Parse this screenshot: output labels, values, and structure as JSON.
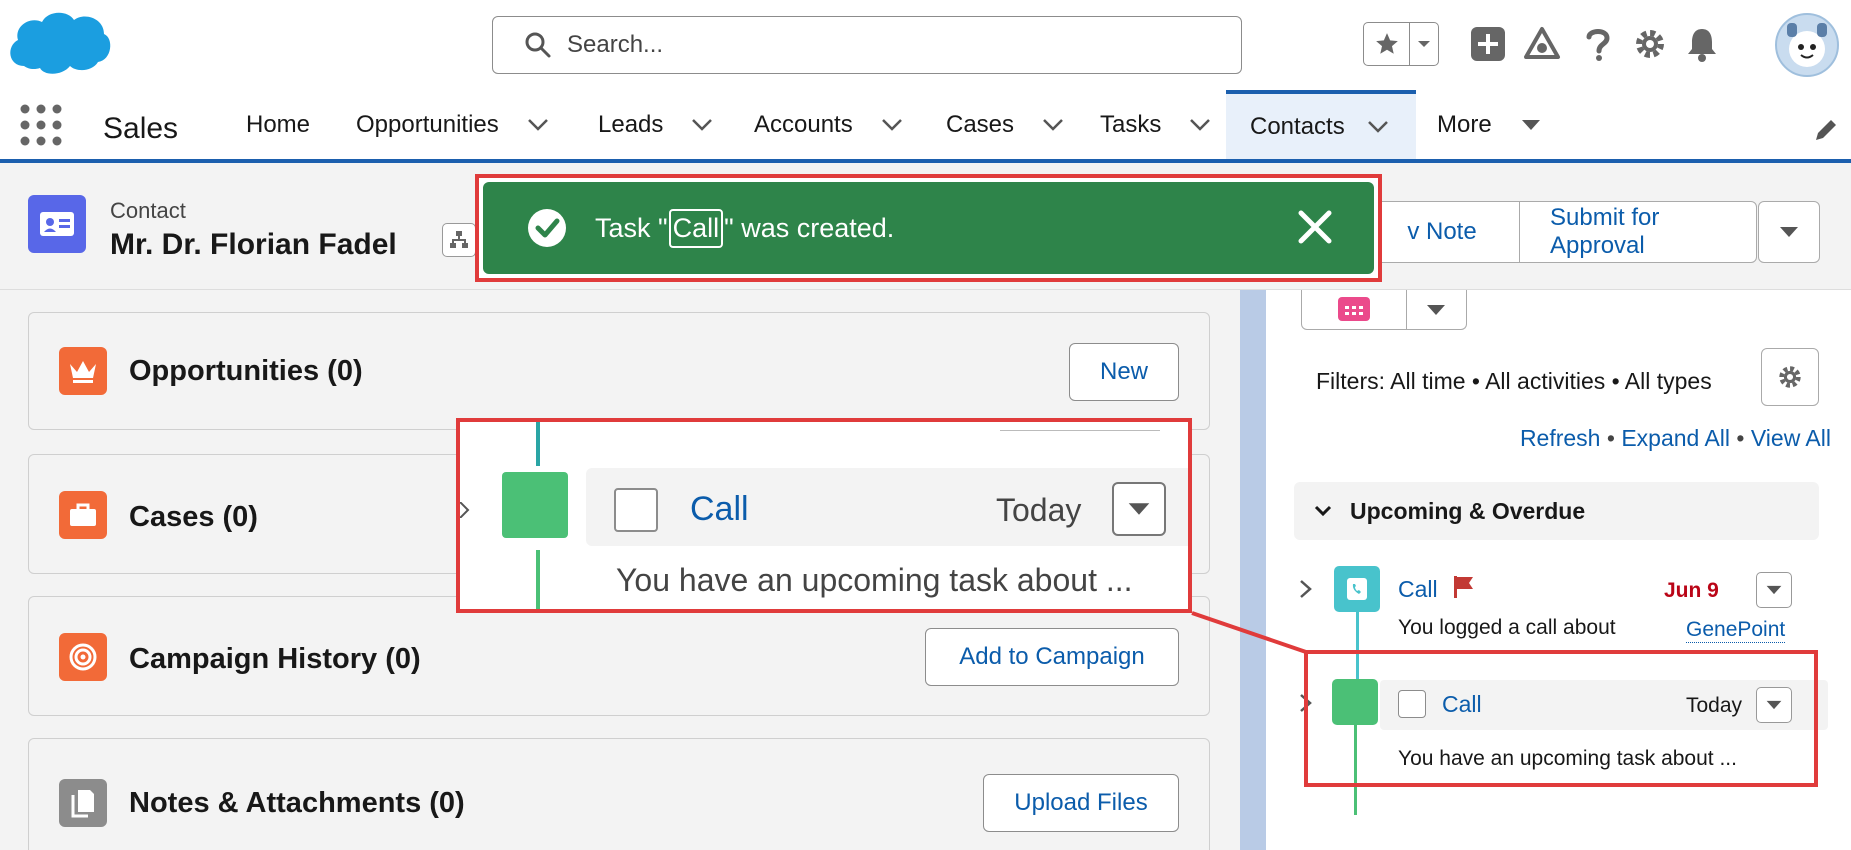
{
  "global_header": {
    "search_placeholder": "Search...",
    "icons": [
      "salesforce-cloud-logo",
      "star-icon",
      "chevron-down-icon",
      "plus-icon",
      "trailhead-icon",
      "help-icon",
      "gear-icon",
      "bell-icon",
      "avatar"
    ]
  },
  "nav": {
    "app_name": "Sales",
    "items": [
      {
        "label": "Home"
      },
      {
        "label": "Opportunities"
      },
      {
        "label": "Leads"
      },
      {
        "label": "Accounts"
      },
      {
        "label": "Cases"
      },
      {
        "label": "Tasks"
      },
      {
        "label": "Contacts",
        "active": true
      },
      {
        "label": "More"
      }
    ]
  },
  "record": {
    "type": "Contact",
    "name": "Mr. Dr. Florian Fadel",
    "actions": [
      "New Note",
      "Submit for Approval"
    ],
    "actions_visible": [
      "v Note",
      "Submit for Approval"
    ]
  },
  "toast": {
    "prefix": "Task \"",
    "highlight": "Call",
    "suffix": "\" was created.",
    "color": "#2e844a"
  },
  "related": [
    {
      "title": "Opportunities (0)",
      "button": "New",
      "icon": "opportunity-crown-icon",
      "color": "#f26a38"
    },
    {
      "title": "Cases (0)",
      "icon": "case-briefcase-icon",
      "color": "#f26a38"
    },
    {
      "title": "Campaign History (0)",
      "button": "Add to Campaign",
      "icon": "campaign-target-icon",
      "color": "#f26a38"
    },
    {
      "title": "Notes & Attachments (0)",
      "button": "Upload Files",
      "icon": "attachment-icon",
      "color": "#8c8c8c"
    }
  ],
  "zoom": {
    "task_title": "Call",
    "task_date": "Today",
    "task_desc": "You have an upcoming task about ..."
  },
  "activity": {
    "filters": "Filters: All time • All activities • All types",
    "links": [
      "Refresh",
      "Expand All",
      "View All"
    ],
    "separator": " • ",
    "section": "Upcoming & Overdue",
    "items": [
      {
        "title": "Call",
        "date": "Jun 9",
        "desc": "You logged a call about",
        "link": "GenePoint",
        "overdue": true
      },
      {
        "title": "Call",
        "date": "Today",
        "desc": "You have an upcoming task about ..."
      }
    ]
  }
}
